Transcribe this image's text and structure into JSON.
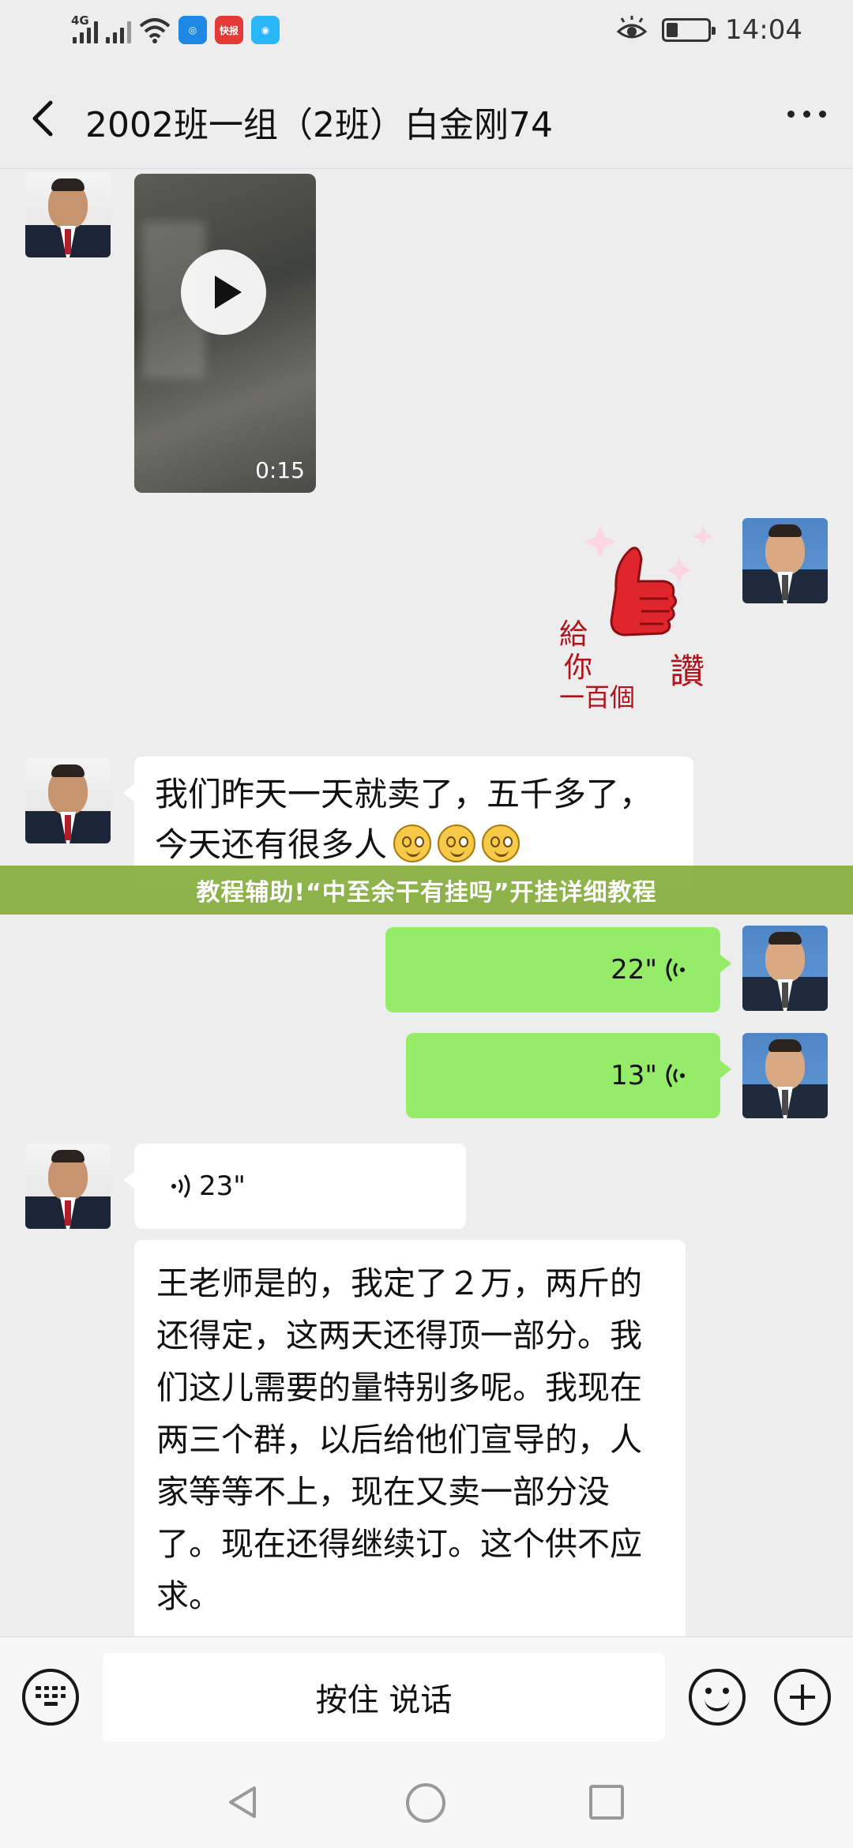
{
  "status_bar": {
    "network_tag": "4G",
    "app1_label": "快报",
    "time": "14:04"
  },
  "header": {
    "title": "2002班一组（2班）白金刚74"
  },
  "messages": {
    "video_duration": "0:15",
    "sticker_text_line1": "給",
    "sticker_text_line2": "你",
    "sticker_text_line3": "一百個",
    "sticker_text_right": "讚",
    "text1": "我们昨天一天就卖了，五千多了，今天还有很多人",
    "voice_out_1": "22\"",
    "voice_out_2": "13\"",
    "voice_in_1": "23\"",
    "text2": "王老师是的，我定了２万，两斤的还得定，这两天还得顶一部分。我们这儿需要的量特别多呢。我现在两三个群，以后给他们宣导的，人家等等不上，现在又卖一部分没了。现在还得继续订。这个供不应求。"
  },
  "banner": {
    "text": "教程辅助!“中至余干有挂吗”开挂详细教程"
  },
  "input_bar": {
    "hold_to_talk": "按住 说话"
  },
  "colors": {
    "background": "#ededed",
    "outgoing_bubble": "#95ec69",
    "incoming_bubble": "#ffffff",
    "banner": "#7eaa32"
  }
}
